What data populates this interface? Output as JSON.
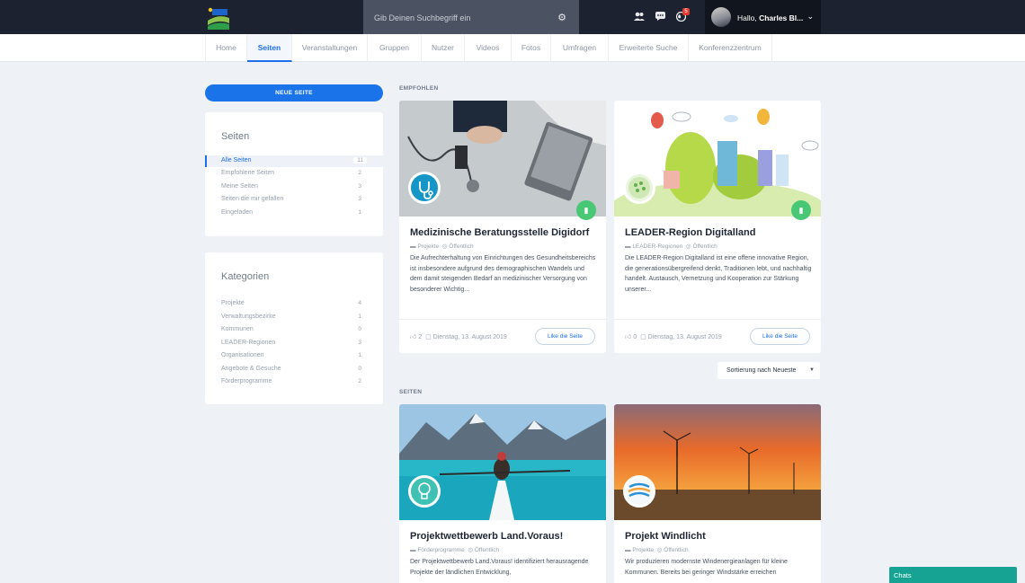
{
  "header": {
    "search_placeholder": "Gib Deinen Suchbegriff ein",
    "notification_count": "5",
    "greeting": "Hallo, ",
    "user_name": "Charles Bl..."
  },
  "nav": {
    "items": [
      {
        "label": "Home"
      },
      {
        "label": "Seiten"
      },
      {
        "label": "Veranstaltungen"
      },
      {
        "label": "Gruppen"
      },
      {
        "label": "Nutzer"
      },
      {
        "label": "Videos"
      },
      {
        "label": "Fotos"
      },
      {
        "label": "Umfragen"
      },
      {
        "label": "Erweiterte Suche"
      },
      {
        "label": "Konferenzzentrum"
      }
    ]
  },
  "sidebar": {
    "new_page_label": "NEUE SEITE",
    "pages_title": "Seiten",
    "pages": [
      {
        "label": "Alle Seiten",
        "count": "11"
      },
      {
        "label": "Empfohlene Seiten",
        "count": "2"
      },
      {
        "label": "Meine Seiten",
        "count": "3"
      },
      {
        "label": "Seiten die mir gefallen",
        "count": "3"
      },
      {
        "label": "Eingeladen",
        "count": "1"
      }
    ],
    "categories_title": "Kategorien",
    "categories": [
      {
        "label": "Projekte",
        "count": "4"
      },
      {
        "label": "Verwaltungsbezirke",
        "count": "1"
      },
      {
        "label": "Kommunen",
        "count": "0"
      },
      {
        "label": "LEADER-Regionen",
        "count": "3"
      },
      {
        "label": "Organisationen",
        "count": "1"
      },
      {
        "label": "Angebote & Gesuche",
        "count": "0"
      },
      {
        "label": "Förderprogramme",
        "count": "2"
      }
    ]
  },
  "featured": {
    "label": "EMPFOHLEN",
    "cards": [
      {
        "title": "Medizinische Beratungsstelle Digidorf",
        "category": "Projekte",
        "privacy": "Öffentlich",
        "description": "Die Aufrechterhaltung von Einrichtungen des Gesundheitsbereichs ist insbesondere aufgrund des demographischen Wandels und dem damit steigenden Bedarf an medizinischer Versorgung von besonderer Wichtig...",
        "likes": "2",
        "date": "Dienstag, 13. August 2019",
        "like_label": "Like die Seite"
      },
      {
        "title": "LEADER-Region Digitalland",
        "category": "LEADER-Regionen",
        "privacy": "Öffentlich",
        "description": "Die LEADER-Region Digitalland ist eine offene innovative Region, die generationsübergreifend denkt, Traditionen lebt, und nachhaltig handelt. Austausch, Vernetzung und Kooperation zur Stärkung unserer...",
        "likes": "0",
        "date": "Dienstag, 13. August 2019",
        "like_label": "Like die Seite"
      }
    ]
  },
  "sort": {
    "label": "Sortierung nach Neueste"
  },
  "pages_section": {
    "label": "SEITEN",
    "cards": [
      {
        "title": "Projektwettbewerb Land.Voraus!",
        "category": "Förderprogramme",
        "privacy": "Öffentlich",
        "description": "Der Projektwettbewerb Land.Voraus! identifiziert herausragende Projekte der ländlichen Entwicklung,"
      },
      {
        "title": "Projekt Windlicht",
        "category": "Projekte",
        "privacy": "Öffentlich",
        "description": "Wir produzieren modernste Windenergieanlagen für kleine Kommunen. Bereits bei geringer Windstärke erreichen"
      }
    ]
  },
  "chat": {
    "label": "Chats"
  },
  "colors": {
    "primary": "#1a73e8",
    "topbar": "#1c2230",
    "chat": "#16a394",
    "bookmark": "#48c774"
  }
}
